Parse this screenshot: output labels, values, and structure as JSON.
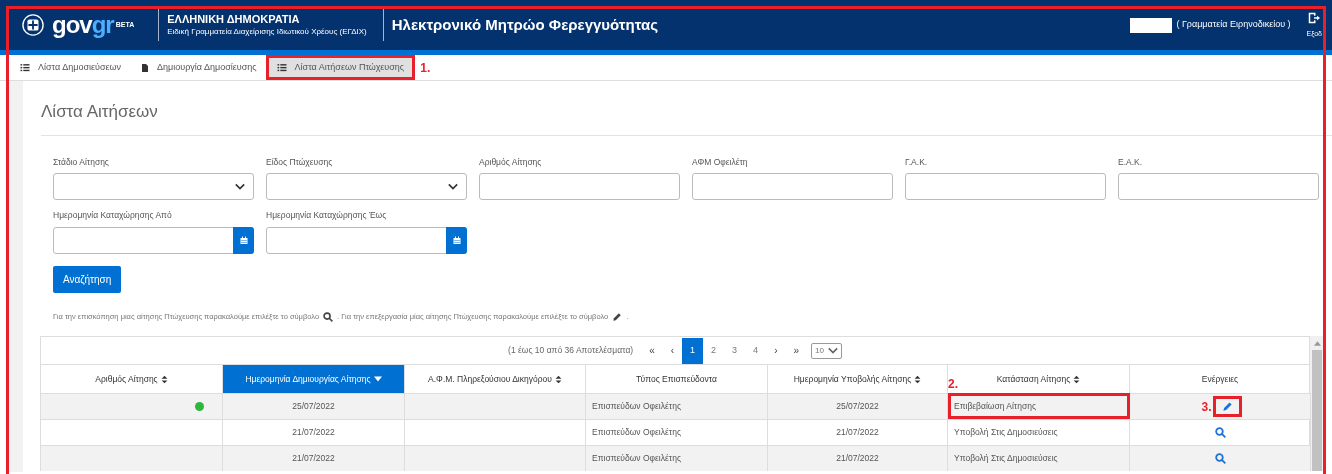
{
  "annotation_frame": true,
  "header": {
    "logo_text_a": "gov",
    "logo_text_b": "gr",
    "logo_badge": "BETA",
    "org_title": "ΕΛΛΗΝΙΚΗ ΔΗΜΟΚΡΑΤΙΑ",
    "org_subtitle": "Ειδική Γραμματεία Διαχείρισης Ιδιωτικού Χρέους (ΕΓΔΙΧ)",
    "app_title": "Ηλεκτρονικό Μητρώο Φερεγγυότητας",
    "user_role": "( Γραμματεία Ειρηνοδικείου )",
    "logout_label": "Εξοδ"
  },
  "nav": [
    {
      "label": "Λίστα Δημοσιεύσεων",
      "kind": "list",
      "selected": false,
      "highlighted": false
    },
    {
      "label": "Δημιουργία Δημοσίευσης",
      "kind": "file",
      "selected": false,
      "highlighted": false
    },
    {
      "label": "Λίστα Αιτήσεων Πτώχευσης",
      "kind": "list",
      "selected": true,
      "highlighted": true,
      "marker": "1."
    }
  ],
  "page_title": "Λίστα Αιτήσεων",
  "filter_rows": [
    [
      {
        "label": "Στάδιο Αίτησης",
        "kind": "select"
      },
      {
        "label": "Είδος Πτώχευσης",
        "kind": "select"
      },
      {
        "label": "Αριθμός Αίτησης",
        "kind": "text"
      },
      {
        "label": "ΑΦΜ Οφειλέτη",
        "kind": "text"
      },
      {
        "label": "Γ.Α.Κ.",
        "kind": "text"
      },
      {
        "label": "Ε.Α.Κ.",
        "kind": "text"
      }
    ],
    [
      {
        "label": "Ημερομηνία Καταχώρησης Από",
        "kind": "date"
      },
      {
        "label": "Ημερομηνία Καταχώρησης Έως",
        "kind": "date"
      }
    ]
  ],
  "search_button": "Αναζήτηση",
  "hint": [
    {
      "kind": "text",
      "text": "Για την επισκόπηση μιας αίτησης Πτώχευσης παρακαλούμε επιλέξτε το σύμβολο"
    },
    {
      "kind": "search"
    },
    {
      "kind": "text",
      "text": ". Για την επεξεργασία μίας αίτησης Πτώχευσης παρακαλούμε επιλέξτε το σύμβολο"
    },
    {
      "kind": "edit"
    },
    {
      "kind": "text",
      "text": "."
    }
  ],
  "pagination": {
    "summary": "(1 έως 10 από 36 Αποτελέσματα)",
    "first": "«",
    "prev": "‹",
    "pages": [
      {
        "label": "1",
        "selected": true
      },
      {
        "label": "2",
        "selected": false
      },
      {
        "label": "3",
        "selected": false
      },
      {
        "label": "4",
        "selected": false
      }
    ],
    "next": "›",
    "last": "»",
    "page_size": "10"
  },
  "table": {
    "columns": [
      {
        "label": "Αριθμός Αίτησης",
        "kind": "sortable",
        "selected": false
      },
      {
        "label": "Ημερομηνία Δημιουργίας Αίτησης",
        "kind": "sorted",
        "selected": true
      },
      {
        "label": "Α.Φ.Μ. Πληρεξούσιου Δικηγόρου",
        "kind": "sortable",
        "selected": false
      },
      {
        "label": "Τύπος Επισπεύδοντα",
        "kind": "plain",
        "selected": false
      },
      {
        "label": "Ημερομηνία Υποβολής Αίτησης",
        "kind": "sortable",
        "selected": false
      },
      {
        "label": "Κατάσταση Αίτησης",
        "kind": "sortable",
        "selected": false
      },
      {
        "label": "Ενέργειες",
        "kind": "plain",
        "selected": false
      }
    ],
    "rows": [
      {
        "color": "#2db83d",
        "created": "25/07/2022",
        "party_type": "Επισπεύδων Οφειλέτης",
        "submitted": "25/07/2022",
        "status": "Επιβεβαίωση Αίτησης",
        "status_highlighted": true,
        "status_marker": "2.",
        "action": {
          "kind": "edit",
          "highlighted": true,
          "marker": "3."
        }
      },
      {
        "created": "21/07/2022",
        "party_type": "Επισπεύδων Οφειλέτης",
        "submitted": "21/07/2022",
        "status": "Υποβολή Στις Δημοσιεύσεις",
        "status_highlighted": false,
        "action": {
          "kind": "search",
          "highlighted": false
        }
      },
      {
        "created": "21/07/2022",
        "party_type": "Επισπεύδων Οφειλέτης",
        "submitted": "21/07/2022",
        "status": "Υποβολή Στις Δημοσιεύσεις",
        "status_highlighted": false,
        "action": {
          "kind": "search",
          "highlighted": false
        }
      }
    ]
  }
}
